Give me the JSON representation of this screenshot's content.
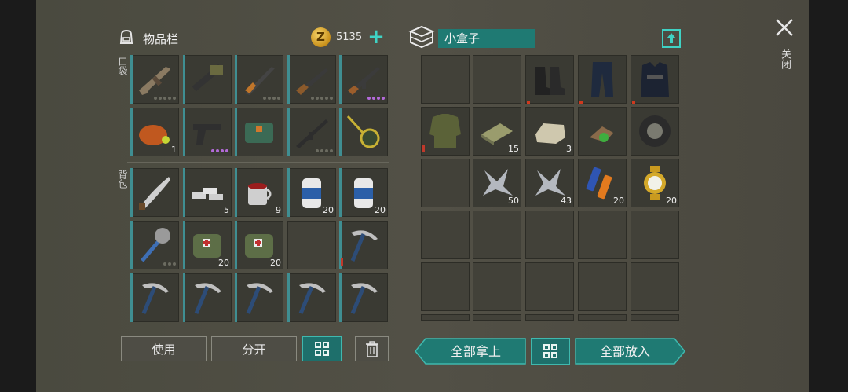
{
  "inventory": {
    "title": "物品栏",
    "coins": "5135",
    "pocket_label": "口袋",
    "backpack_label": "背包",
    "pocket": [
      {
        "icon": "assault-rifle-icon",
        "dots": [
          0,
          0,
          0,
          0,
          0
        ]
      },
      {
        "icon": "rocket-launcher-icon",
        "dots": []
      },
      {
        "icon": "hunting-rifle-icon",
        "dots": [
          0,
          0,
          0,
          0
        ]
      },
      {
        "icon": "shotgun-icon",
        "dots": [
          0,
          0,
          0,
          0,
          0
        ]
      },
      {
        "icon": "ak-rifle-icon",
        "dots": [
          1,
          1,
          1,
          1
        ]
      },
      {
        "icon": "roast-chicken-icon",
        "qty": "1"
      },
      {
        "icon": "pistol-icon",
        "dots": [
          1,
          1,
          1,
          1
        ]
      },
      {
        "icon": "medkit-bag-icon",
        "dots": []
      },
      {
        "icon": "rifle-icon",
        "dots": [
          0,
          0,
          0,
          0
        ]
      },
      {
        "icon": "magnifier-icon",
        "dots": []
      }
    ],
    "backpack": [
      {
        "icon": "machete-icon",
        "dots": []
      },
      {
        "icon": "metal-ingot-icon",
        "qty": "5"
      },
      {
        "icon": "mug-icon",
        "qty": "9"
      },
      {
        "icon": "soda-can-icon",
        "qty": "20"
      },
      {
        "icon": "soda-can-icon",
        "qty": "20"
      },
      {
        "icon": "saw-blade-mace-icon",
        "dots": [
          0,
          0,
          0
        ]
      },
      {
        "icon": "first-aid-pouch-icon",
        "qty": "20"
      },
      {
        "icon": "first-aid-pouch-icon",
        "qty": "20"
      },
      {
        "icon": "empty-slot",
        "empty": true
      },
      {
        "icon": "pickaxe-icon",
        "red": true
      },
      {
        "icon": "pickaxe-icon"
      },
      {
        "icon": "pickaxe-icon"
      },
      {
        "icon": "pickaxe-icon"
      },
      {
        "icon": "pickaxe-icon"
      },
      {
        "icon": "pickaxe-icon"
      }
    ],
    "buttons": {
      "use": "使用",
      "split": "分开"
    }
  },
  "container": {
    "name": "小盒子",
    "slots": [
      {
        "icon": "empty-slot",
        "empty": true
      },
      {
        "icon": "empty-slot",
        "empty": true
      },
      {
        "icon": "boots-icon",
        "redtick": true
      },
      {
        "icon": "tactical-pants-icon",
        "redtick": true
      },
      {
        "icon": "police-vest-icon",
        "redtick": true
      },
      {
        "icon": "military-jacket-icon",
        "red": true
      },
      {
        "icon": "cloth-icon",
        "qty": "15"
      },
      {
        "icon": "stone-icon",
        "qty": "3"
      },
      {
        "icon": "herb-icon"
      },
      {
        "icon": "tire-icon"
      },
      {
        "icon": "empty-slot",
        "empty": true
      },
      {
        "icon": "metal-scrap-icon",
        "qty": "50"
      },
      {
        "icon": "metal-scrap-icon",
        "qty": "43"
      },
      {
        "icon": "battery-icon",
        "qty": "20"
      },
      {
        "icon": "gold-watch-icon",
        "qty": "20"
      }
    ],
    "take_all": "全部拿上",
    "put_all": "全部放入"
  },
  "close_label": "关闭",
  "colors": {
    "accent": "#1f7a73",
    "accent_border": "#3fb8ae",
    "slot_bar": "#3f8e92",
    "rare_dot": "#b36ad9"
  }
}
